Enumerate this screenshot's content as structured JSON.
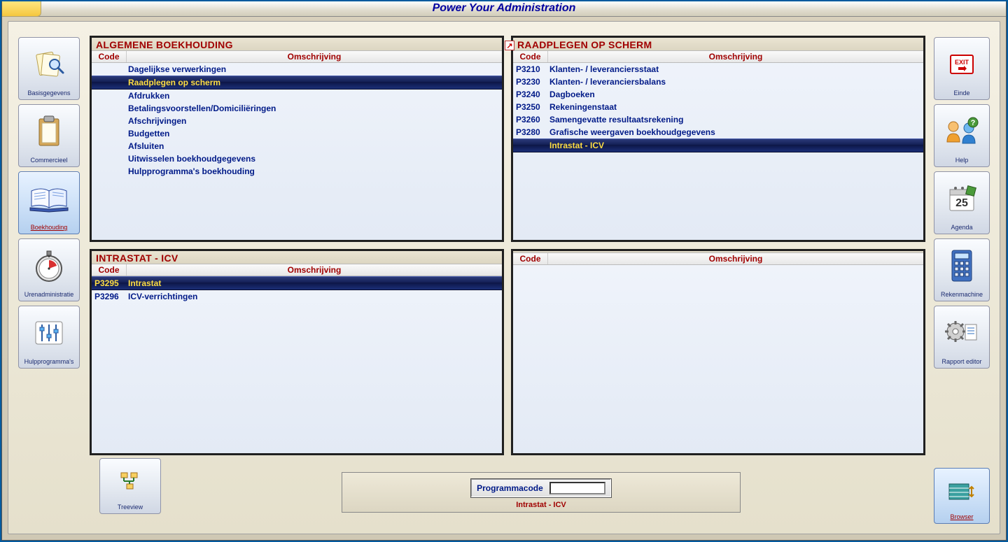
{
  "title": "Power Your Administration",
  "sidebar_left": {
    "basisgegevens": "Basisgegevens",
    "commercieel": "Commercieel",
    "boekhouding": "Boekhouding",
    "urenadministratie": "Urenadministratie",
    "hulpprogrammas": "Hulpprogramma's"
  },
  "sidebar_right": {
    "einde": "Einde",
    "help": "Help",
    "agenda": "Agenda",
    "rekenmachine": "Rekenmachine",
    "rapport_editor": "Rapport editor"
  },
  "panel_headers": {
    "code": "Code",
    "desc": "Omschrijving"
  },
  "panel1": {
    "title": "ALGEMENE BOEKHOUDING",
    "rows": [
      {
        "code": "",
        "desc": "Dagelijkse verwerkingen",
        "selected": false
      },
      {
        "code": "",
        "desc": "Raadplegen op scherm",
        "selected": true
      },
      {
        "code": "",
        "desc": "Afdrukken",
        "selected": false
      },
      {
        "code": "",
        "desc": "Betalingsvoorstellen/Domiciliëringen",
        "selected": false
      },
      {
        "code": "",
        "desc": "Afschrijvingen",
        "selected": false
      },
      {
        "code": "",
        "desc": "Budgetten",
        "selected": false
      },
      {
        "code": "",
        "desc": "Afsluiten",
        "selected": false
      },
      {
        "code": "",
        "desc": "Uitwisselen boekhoudgegevens",
        "selected": false
      },
      {
        "code": "",
        "desc": "Hulpprogramma's boekhouding",
        "selected": false
      }
    ]
  },
  "panel2": {
    "title": "RAADPLEGEN OP SCHERM",
    "rows": [
      {
        "code": "P3210",
        "desc": "Klanten- / leveranciersstaat",
        "selected": false
      },
      {
        "code": "P3230",
        "desc": "Klanten- / leveranciersbalans",
        "selected": false
      },
      {
        "code": "P3240",
        "desc": "Dagboeken",
        "selected": false
      },
      {
        "code": "P3250",
        "desc": "Rekeningenstaat",
        "selected": false
      },
      {
        "code": "P3260",
        "desc": "Samengevatte resultaatsrekening",
        "selected": false
      },
      {
        "code": "P3280",
        "desc": "Grafische weergaven boekhoudgegevens",
        "selected": false
      },
      {
        "code": "",
        "desc": "Intrastat - ICV",
        "selected": true
      }
    ]
  },
  "panel3": {
    "title": "INTRASTAT - ICV",
    "rows": [
      {
        "code": "P3295",
        "desc": "Intrastat",
        "selected": true
      },
      {
        "code": "P3296",
        "desc": "ICV-verrichtingen",
        "selected": false
      }
    ]
  },
  "panel4": {
    "title": "",
    "rows": []
  },
  "footer": {
    "treeview": "Treeview",
    "programmacode_label": "Programmacode",
    "programmacode_value": "",
    "caption": "Intrastat - ICV",
    "browser": "Browser"
  }
}
